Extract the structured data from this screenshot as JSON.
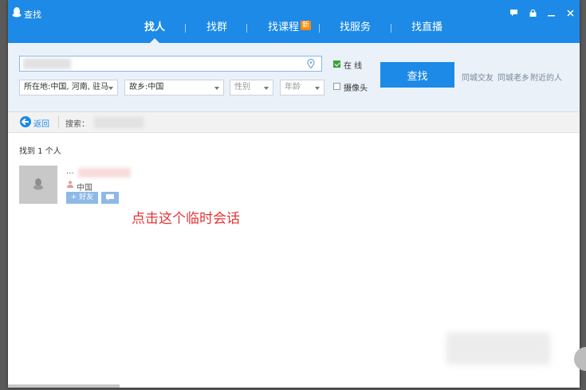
{
  "window": {
    "title": "查找",
    "controls": [
      "feedback-icon",
      "lock-icon",
      "minimize-icon",
      "close-icon"
    ]
  },
  "tabs": [
    {
      "label": "找人",
      "active": true
    },
    {
      "label": "找群",
      "active": false
    },
    {
      "label": "找课程",
      "active": false,
      "badge": "新"
    },
    {
      "label": "找服务",
      "active": false
    },
    {
      "label": "找直播",
      "active": false
    }
  ],
  "search": {
    "keyword_placeholder": "",
    "location": "所在地:中国, 河南, 驻马",
    "hometown": "故乡:中国",
    "gender": "性别",
    "age": "年龄",
    "online_label": "在 线",
    "online_checked": true,
    "camera_label": "摄像头",
    "camera_checked": false,
    "find_button": "查找",
    "quick_links": [
      "同城交友",
      "同城老乡",
      "附近的人"
    ]
  },
  "backbar": {
    "back_label": "返回",
    "search_label": "搜索："
  },
  "results": {
    "count_text": "找到 1 个人",
    "items": [
      {
        "name": "...",
        "location": "中国",
        "add_friend_label": "+ 好友"
      }
    ]
  },
  "annotation": "点击这个临时会话",
  "colors": {
    "accent": "#1c8ae6",
    "panel": "#eaf1f9",
    "annotation": "#e53333",
    "badge": "#ff8a00"
  }
}
